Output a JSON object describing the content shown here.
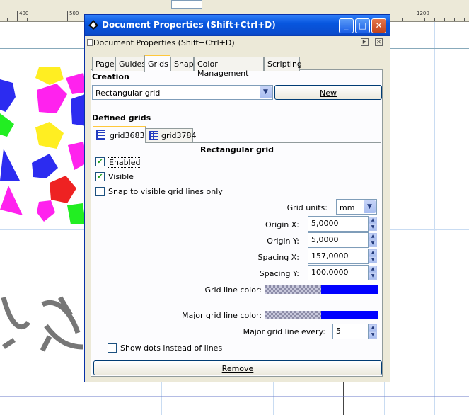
{
  "ruler": {
    "labels": [
      "400",
      "500",
      "1200"
    ]
  },
  "toolbar": {
    "field_value": ""
  },
  "dialog": {
    "title": "Document Properties (Shift+Ctrl+D)",
    "subtitle": "Document Properties (Shift+Ctrl+D)",
    "window_buttons": {
      "minimize": "_",
      "maximize": "□",
      "close": "✕"
    },
    "tabs": [
      {
        "label": "Page"
      },
      {
        "label": "Guides"
      },
      {
        "label": "Grids"
      },
      {
        "label": "Snap"
      },
      {
        "label": "Color Management"
      },
      {
        "label": "Scripting"
      }
    ],
    "active_tab": "Grids",
    "creation": {
      "heading": "Creation",
      "grid_type": "Rectangular grid",
      "new_button": "New"
    },
    "defined": {
      "heading": "Defined grids",
      "grids": [
        {
          "label": "grid3683"
        },
        {
          "label": "grid3784"
        }
      ]
    },
    "grid": {
      "heading": "Rectangular grid",
      "enabled_label": "Enabled",
      "enabled": true,
      "visible_label": "Visible",
      "visible": true,
      "snap_visible_label": "Snap to visible grid lines only",
      "snap_visible": false,
      "units_label": "Grid units:",
      "units_value": "mm",
      "origin_x_label": "Origin X:",
      "origin_x_value": "5,0000",
      "origin_y_label": "Origin Y:",
      "origin_y_value": "5,0000",
      "spacing_x_label": "Spacing X:",
      "spacing_x_value": "157,0000",
      "spacing_y_label": "Spacing Y:",
      "spacing_y_value": "100,0000",
      "line_color_label": "Grid line color:",
      "line_color": "#0000ff",
      "major_color_label": "Major grid line color:",
      "major_color": "#0000ff",
      "major_every_label": "Major grid line every:",
      "major_every_value": "5",
      "show_dots_label": "Show dots instead of lines",
      "show_dots": false
    },
    "remove_button": "Remove"
  },
  "colors": {
    "title_bar": "#0a4bcc",
    "dialog_bg": "#ece9d8",
    "grid_line": "#c9dcf2"
  }
}
